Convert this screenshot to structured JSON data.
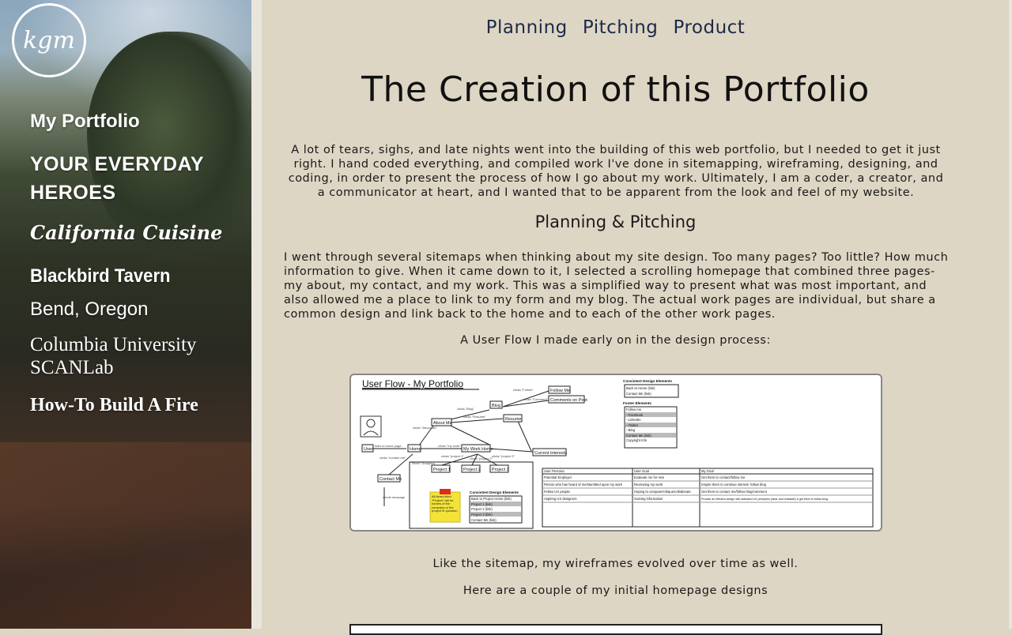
{
  "sidebar": {
    "logo_text": "kgm",
    "items": [
      {
        "label": "My Portfolio"
      },
      {
        "label": "YOUR EVERYDAY HEROES"
      },
      {
        "label": "California Cuisine"
      },
      {
        "label": "Blackbird Tavern"
      },
      {
        "label": "Bend, Oregon"
      },
      {
        "label": "Columbia University SCANLab"
      },
      {
        "label": "How-To Build A Fire"
      }
    ]
  },
  "topnav": [
    "Planning",
    "Pitching",
    "Product"
  ],
  "main": {
    "title": "The Creation of this Portfolio",
    "intro": "A lot of tears, sighs, and late nights went into the building of this web portfolio, but I needed to get it just right. I hand coded everything, and compiled work I've done in sitemapping, wireframing, designing, and coding, in order to present the process of how I go about my work. Ultimately, I am a coder, a creator, and a communicator at heart, and I wanted that to be apparent from the look and feel of my website.",
    "section_heading": "Planning & Pitching",
    "paragraph": "I went through several sitemaps when thinking about my site design. Too many pages? Too little? How much information to give. When it came down to it, I selected a scrolling homepage that combined three pages- my about, my contact, and my work. This was a simplified way to present what was most important, and also allowed me a place to link to my form and my blog. The actual work pages are individual, but share a common design and link back to the home and to each of the other work pages.",
    "caption_userflow": "A User Flow I made early on in the design process:",
    "caption_wireframes": "Like the sitemap, my wireframes evolved over time as well.",
    "caption_homepage": "Here are a couple of my initial homepage designs"
  },
  "diagram": {
    "title": "User Flow - My Portfolio",
    "nodes": [
      "User",
      "Home",
      "About Me",
      "Blog",
      "Resume",
      "Follow Me",
      "Comments on Post",
      "My Work Home",
      "Current Interests",
      "Contact Me",
      "Project 1",
      "Project 2",
      "Project 3"
    ],
    "edge_labels": [
      "links to home page",
      "clicks \"About Me\"",
      "clicks \"Blog\"",
      "clicks \"Resume\"",
      "clicks \"Follow\"",
      "clicks \"Comment\"",
      "clicks \"my work\"",
      "clicks \"contact me\"",
      "clicks \"project 1\"",
      "clicks \"project 2\"",
      "clicks \"project 3\"",
      "sends message",
      "\"Work\" Grouping"
    ],
    "sticky_note": "All items titled \"Project\" will be names of the company or the project in question",
    "consistent_elements_title": "Consistent Design Elements",
    "consistent_elements": [
      "Back to Home (link)",
      "Contact Me (link)"
    ],
    "footer_elements_title": "Footer Elements",
    "footer_elements": [
      "Follow me",
      "--Facebook",
      "--LinkedIn",
      "--Twitter",
      "--Blog",
      "Contact Me (link)",
      "Copyright Info"
    ],
    "project_elements_title": "Consistent Design Elements",
    "project_elements": [
      "Back to Project Home (link)",
      "Project 1 (link)",
      "Project 2 (link)",
      "Project 3 (link)",
      "Contact Me (link)"
    ],
    "table_headers": [
      "User Persona",
      "User Goal",
      "My Goal"
    ],
    "table_rows": [
      [
        "Potential Employer",
        "Evaluate me for Hire",
        "Get them to contact/follow me"
      ],
      [
        "Person who has heard of me/stumbled upon my work",
        "Reviewing my work",
        "Inspire them to continue interest- follow blog"
      ],
      [
        "Fellow UX people",
        "Hoping to compare/critique/collaborate",
        "Get them to contact me/follow blog/comment"
      ],
      [
        "Aspiring UX designers",
        "Gaining information",
        "Provide an efficient design with standard UX principles (clear and relatable) & get them to follow blog"
      ]
    ]
  }
}
